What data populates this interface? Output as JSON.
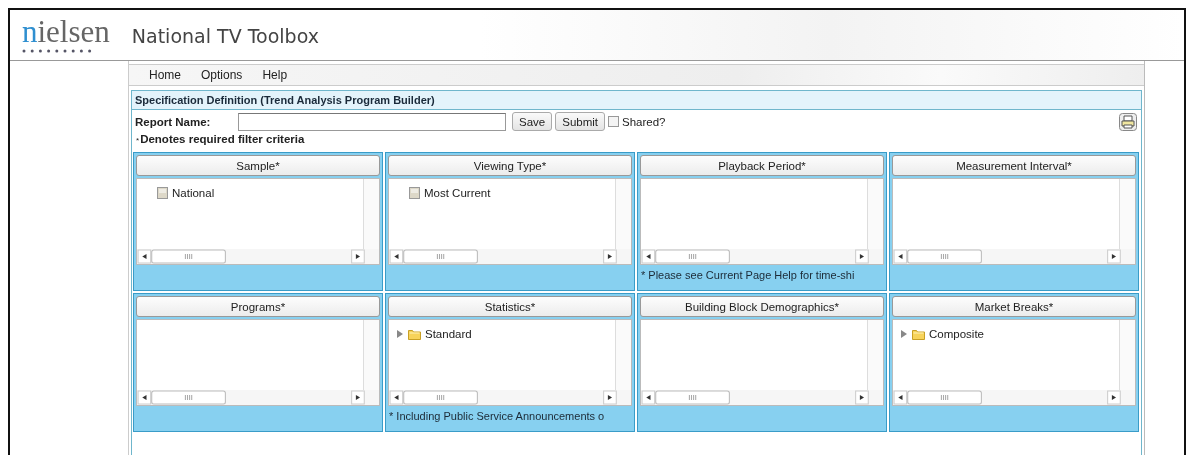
{
  "header": {
    "logo": "nielsen",
    "title": "National TV Toolbox"
  },
  "menu": [
    {
      "label": "Home"
    },
    {
      "label": "Options"
    },
    {
      "label": "Help"
    }
  ],
  "spec": {
    "title": "Specification Definition (Trend Analysis Program Builder)",
    "report_name_label": "Report Name:",
    "buttons": [
      "Save",
      "Submit"
    ],
    "shared": {
      "label": "Shared?",
      "checked": false
    },
    "required_note_mark": "*",
    "required_note": "Denotes required filter criteria"
  },
  "panels": [
    {
      "title": "Sample*",
      "items": [
        {
          "kind": "leaf",
          "label": "National"
        }
      ]
    },
    {
      "title": "Viewing Type*",
      "items": [
        {
          "kind": "leaf",
          "label": "Most Current"
        }
      ]
    },
    {
      "title": "Playback Period*",
      "note": "* Please see Current Page Help for time-shi"
    },
    {
      "title": "Measurement Interval*"
    },
    {
      "title": "Programs*"
    },
    {
      "title": "Statistics*",
      "items": [
        {
          "kind": "folder",
          "label": "Standard",
          "expanded": false
        }
      ],
      "note": "* Including Public Service Announcements o"
    },
    {
      "title": "Building Block Demographics*"
    },
    {
      "title": "Market Breaks*",
      "items": [
        {
          "kind": "folder",
          "label": "Composite",
          "expanded": false
        }
      ]
    }
  ]
}
